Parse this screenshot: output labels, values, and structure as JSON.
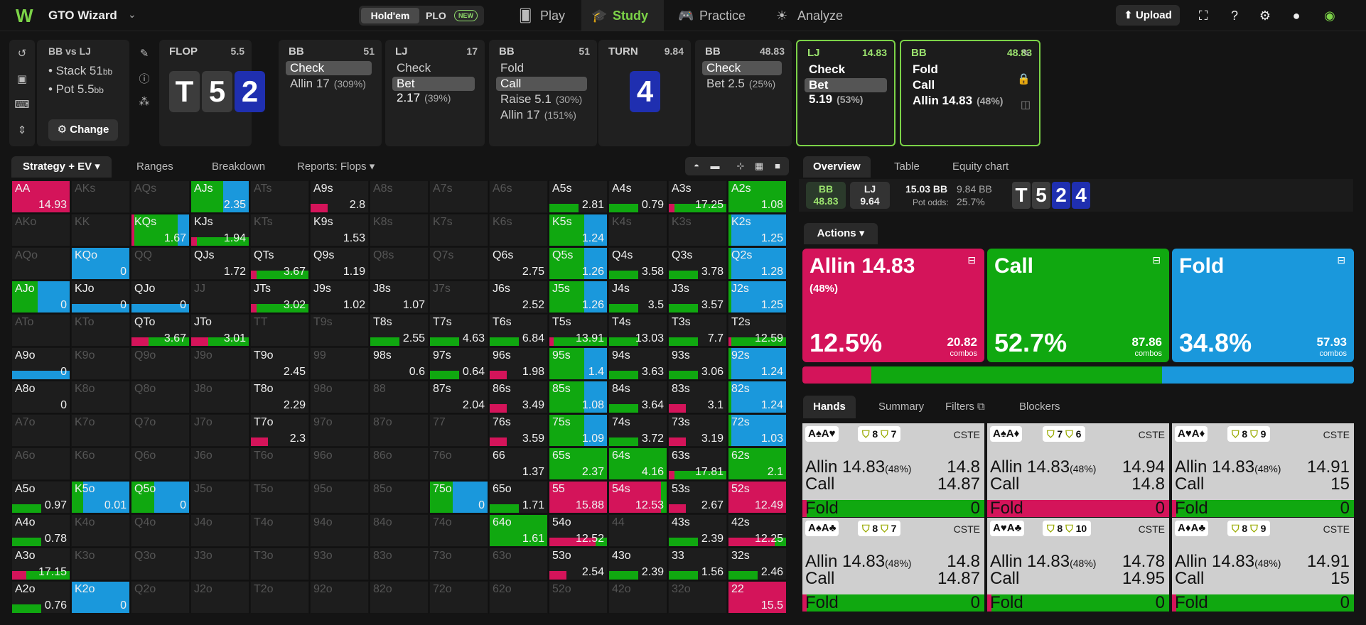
{
  "nav": {
    "brand": "GTO Wizard",
    "holdem": "Hold'em",
    "plo": "PLO",
    "new_badge": "NEW",
    "tabs": [
      "Play",
      "Study",
      "Practice",
      "Analyze"
    ],
    "upload": "Upload"
  },
  "spot": {
    "title": "BB vs LJ",
    "stack_label": "• Stack 51",
    "stack_unit": "bb",
    "pot_label": "• Pot 5.5",
    "pot_unit": "bb",
    "change": "Change"
  },
  "streets": [
    {
      "name": "FLOP",
      "pot": "5.5",
      "cards": [
        "T",
        "5",
        "2"
      ]
    },
    {
      "name": "BB",
      "pot": "51",
      "actions": [
        {
          "label": "Check",
          "sel": true
        },
        {
          "label": "Allin 17",
          "pct": "(309%)"
        }
      ]
    },
    {
      "name": "LJ",
      "pot": "17",
      "actions": [
        {
          "label": "Check"
        },
        {
          "label": "Bet 2.17",
          "pct": "(39%)",
          "sel": true
        }
      ]
    },
    {
      "name": "BB",
      "pot": "51",
      "actions": [
        {
          "label": "Fold"
        },
        {
          "label": "Call",
          "sel": true
        },
        {
          "label": "Raise 5.1",
          "pct": "(30%)"
        },
        {
          "label": "Allin 17",
          "pct": "(151%)"
        }
      ]
    },
    {
      "name": "TURN",
      "pot": "9.84",
      "cards": [
        "4"
      ]
    },
    {
      "name": "BB",
      "pot": "48.83",
      "actions": [
        {
          "label": "Check",
          "sel": true
        },
        {
          "label": "Bet 2.5",
          "pct": "(25%)"
        }
      ]
    },
    {
      "name": "LJ",
      "pot": "14.83",
      "actions": [
        {
          "label": "Check"
        },
        {
          "label": "Bet 5.19",
          "pct": "(53%)",
          "sel": true
        }
      ]
    },
    {
      "name": "BB",
      "pot": "48.83",
      "actions": [
        {
          "label": "Fold"
        },
        {
          "label": "Call"
        },
        {
          "label": "Allin 14.83",
          "pct": "(48%)"
        }
      ]
    }
  ],
  "left_tabs": [
    "Strategy + EV",
    "Ranges",
    "Breakdown",
    "Reports: Flops"
  ],
  "right_tabs": [
    "Overview",
    "Table",
    "Equity chart"
  ],
  "info": {
    "bb": "BB",
    "bb_val": "48.83",
    "lj": "LJ",
    "lj_val": "9.64",
    "pot": "15.03 BB",
    "pot2": "9.84 BB",
    "odds_label": "Pot odds:",
    "odds": "25.7%",
    "board": [
      "T",
      "5",
      "2",
      "4"
    ]
  },
  "actions_label": "Actions",
  "action_boxes": [
    {
      "name": "Allin 14.83",
      "sub": "(48%)",
      "pct": "12.5%",
      "combos": "20.82",
      "combos_label": "combos",
      "color": "#d4145a"
    },
    {
      "name": "Call",
      "sub": "",
      "pct": "52.7%",
      "combos": "87.86",
      "combos_label": "combos",
      "color": "#10a810"
    },
    {
      "name": "Fold",
      "sub": "",
      "pct": "34.8%",
      "combos": "57.93",
      "combos_label": "combos",
      "color": "#1a98dc"
    }
  ],
  "distribution": [
    12.5,
    52.7,
    34.8
  ],
  "hand_tabs": [
    "Hands",
    "Summary",
    "Filters",
    "Blockers"
  ],
  "hands": [
    {
      "cards": "A♠A♥",
      "blk1": "8",
      "blk2": "7",
      "cat": "CSTE",
      "allin": "14.8",
      "call": "14.87",
      "fold": "0",
      "fold_color": "#10a810"
    },
    {
      "cards": "A♠A♦",
      "blk1": "7",
      "blk2": "6",
      "cat": "CSTE",
      "allin": "14.94",
      "call": "14.8",
      "fold": "0",
      "fold_color": "#d4145a"
    },
    {
      "cards": "A♥A♦",
      "blk1": "8",
      "blk2": "9",
      "cat": "CSTE",
      "allin": "14.91",
      "call": "15",
      "fold": "0",
      "fold_color": "#10a810"
    },
    {
      "cards": "A♠A♣",
      "blk1": "8",
      "blk2": "7",
      "cat": "CSTE",
      "allin": "14.8",
      "call": "14.87",
      "fold": "0",
      "fold_color": "#10a810"
    },
    {
      "cards": "A♥A♣",
      "blk1": "8",
      "blk2": "10",
      "cat": "CSTE",
      "allin": "14.78",
      "call": "14.95",
      "fold": "0",
      "fold_color": "#10a810"
    },
    {
      "cards": "A♦A♣",
      "blk1": "8",
      "blk2": "9",
      "cat": "CSTE",
      "allin": "14.91",
      "call": "15",
      "fold": "0",
      "fold_color": "#10a810"
    }
  ],
  "hand_labels": {
    "allin": "Allin 14.83",
    "allin_pct": "(48%)",
    "call": "Call",
    "fold": "Fold"
  },
  "colors": {
    "allin": "#d4145a",
    "call": "#10a810",
    "fold": "#1a98dc",
    "accent": "#7cd348"
  },
  "grid": [
    [
      [
        "AA",
        "14.93",
        "A",
        100
      ],
      [
        "AKs",
        "",
        "",
        0
      ],
      [
        "AQs",
        "",
        "",
        0
      ],
      [
        "AJs",
        "2.35",
        "mix",
        0
      ],
      [
        "ATs",
        "",
        "",
        0
      ],
      [
        "A9s",
        "2.8",
        "ar",
        0
      ],
      [
        "A8s",
        "",
        "",
        0
      ],
      [
        "A7s",
        "",
        "",
        0
      ],
      [
        "A6s",
        "",
        "",
        0
      ],
      [
        "A5s",
        "2.81",
        "cl",
        0
      ],
      [
        "A4s",
        "0.79",
        "cl",
        0
      ],
      [
        "A3s",
        "17.25",
        "acl",
        0
      ],
      [
        "A2s",
        "1.08",
        "C",
        0
      ]
    ],
    [
      [
        "AKo",
        "",
        "",
        0
      ],
      [
        "KK",
        "",
        "",
        0
      ],
      [
        "KQs",
        "1.67",
        "kqs",
        0
      ],
      [
        "KJs",
        "1.94",
        "acl",
        0
      ],
      [
        "KTs",
        "",
        "",
        0
      ],
      [
        "K9s",
        "1.53",
        "",
        0
      ],
      [
        "K8s",
        "",
        "",
        0
      ],
      [
        "K7s",
        "",
        "",
        0
      ],
      [
        "K6s",
        "",
        "",
        0
      ],
      [
        "K5s",
        "1.24",
        "cf",
        0
      ],
      [
        "K4s",
        "",
        "",
        0
      ],
      [
        "K3s",
        "",
        "",
        0
      ],
      [
        "K2s",
        "1.25",
        "cf2",
        0
      ]
    ],
    [
      [
        "AQo",
        "",
        "",
        0
      ],
      [
        "KQo",
        "0",
        "F",
        0
      ],
      [
        "QQ",
        "",
        "",
        0
      ],
      [
        "QJs",
        "1.72",
        "",
        0
      ],
      [
        "QTs",
        "3.67",
        "acl",
        0
      ],
      [
        "Q9s",
        "1.19",
        "",
        0
      ],
      [
        "Q8s",
        "",
        "",
        0
      ],
      [
        "Q7s",
        "",
        "",
        0
      ],
      [
        "Q6s",
        "2.75",
        "",
        0
      ],
      [
        "Q5s",
        "1.26",
        "cf3",
        0
      ],
      [
        "Q4s",
        "3.58",
        "cl",
        0
      ],
      [
        "Q3s",
        "3.78",
        "cl",
        0
      ],
      [
        "Q2s",
        "1.28",
        "cf2",
        0
      ]
    ],
    [
      [
        "AJo",
        "0",
        "ajo",
        0
      ],
      [
        "KJo",
        "0",
        "fl",
        0
      ],
      [
        "QJo",
        "0",
        "fl",
        0
      ],
      [
        "JJ",
        "",
        "",
        0
      ],
      [
        "JTs",
        "3.02",
        "acl",
        0
      ],
      [
        "J9s",
        "1.02",
        "",
        0
      ],
      [
        "J8s",
        "1.07",
        "",
        0
      ],
      [
        "J7s",
        "",
        "",
        0
      ],
      [
        "J6s",
        "2.52",
        "",
        0
      ],
      [
        "J5s",
        "1.26",
        "cf3",
        0
      ],
      [
        "J4s",
        "3.5",
        "cl",
        0
      ],
      [
        "J3s",
        "3.57",
        "cl",
        0
      ],
      [
        "J2s",
        "1.25",
        "cf2",
        0
      ]
    ],
    [
      [
        "ATo",
        "",
        "",
        0
      ],
      [
        "KTo",
        "",
        "",
        0
      ],
      [
        "QTo",
        "3.67",
        "qto",
        0
      ],
      [
        "JTo",
        "3.01",
        "qto",
        0
      ],
      [
        "TT",
        "",
        "",
        0
      ],
      [
        "T9s",
        "",
        "",
        0
      ],
      [
        "T8s",
        "2.55",
        "cl",
        0
      ],
      [
        "T7s",
        "4.63",
        "cl",
        0
      ],
      [
        "T6s",
        "6.84",
        "cl",
        0
      ],
      [
        "T5s",
        "13.91",
        "t5s",
        0
      ],
      [
        "T4s",
        "13.03",
        "cl",
        0
      ],
      [
        "T3s",
        "7.7",
        "cl",
        0
      ],
      [
        "T2s",
        "12.59",
        "t2s",
        0
      ]
    ],
    [
      [
        "A9o",
        "0",
        "fl",
        0
      ],
      [
        "K9o",
        "",
        "",
        0
      ],
      [
        "Q9o",
        "",
        "",
        0
      ],
      [
        "J9o",
        "",
        "",
        0
      ],
      [
        "T9o",
        "2.45",
        "",
        0
      ],
      [
        "99",
        "",
        "",
        0
      ],
      [
        "98s",
        "0.6",
        "",
        0
      ],
      [
        "97s",
        "0.64",
        "cl",
        0
      ],
      [
        "96s",
        "1.98",
        "ar",
        0
      ],
      [
        "95s",
        "1.4",
        "cf",
        0
      ],
      [
        "94s",
        "3.63",
        "cl",
        0
      ],
      [
        "93s",
        "3.06",
        "cl",
        0
      ],
      [
        "92s",
        "1.24",
        "cf2",
        0
      ]
    ],
    [
      [
        "A8o",
        "0",
        "",
        0
      ],
      [
        "K8o",
        "",
        "",
        0
      ],
      [
        "Q8o",
        "",
        "",
        0
      ],
      [
        "J8o",
        "",
        "",
        0
      ],
      [
        "T8o",
        "2.29",
        "",
        0
      ],
      [
        "98o",
        "",
        "",
        0
      ],
      [
        "88",
        "",
        "",
        0
      ],
      [
        "87s",
        "2.04",
        "",
        0
      ],
      [
        "86s",
        "3.49",
        "ar",
        0
      ],
      [
        "85s",
        "1.08",
        "cf",
        0
      ],
      [
        "84s",
        "3.64",
        "cl",
        0
      ],
      [
        "83s",
        "3.1",
        "ar",
        0
      ],
      [
        "82s",
        "1.24",
        "cf2",
        0
      ]
    ],
    [
      [
        "A7o",
        "",
        "",
        0
      ],
      [
        "K7o",
        "",
        "",
        0
      ],
      [
        "Q7o",
        "",
        "",
        0
      ],
      [
        "J7o",
        "",
        "",
        0
      ],
      [
        "T7o",
        "2.3",
        "ar",
        0
      ],
      [
        "97o",
        "",
        "",
        0
      ],
      [
        "87o",
        "",
        "",
        0
      ],
      [
        "77",
        "",
        "",
        0
      ],
      [
        "76s",
        "3.59",
        "ar",
        0
      ],
      [
        "75s",
        "1.09",
        "cf",
        0
      ],
      [
        "74s",
        "3.72",
        "cl",
        0
      ],
      [
        "73s",
        "3.19",
        "ar",
        0
      ],
      [
        "72s",
        "1.03",
        "cf2",
        0
      ]
    ],
    [
      [
        "A6o",
        "",
        "",
        0
      ],
      [
        "K6o",
        "",
        "",
        0
      ],
      [
        "Q6o",
        "",
        "",
        0
      ],
      [
        "J6o",
        "",
        "",
        0
      ],
      [
        "T6o",
        "",
        "",
        0
      ],
      [
        "96o",
        "",
        "",
        0
      ],
      [
        "86o",
        "",
        "",
        0
      ],
      [
        "76o",
        "",
        "",
        0
      ],
      [
        "66",
        "1.37",
        "",
        0
      ],
      [
        "65s",
        "2.37",
        "C",
        0
      ],
      [
        "64s",
        "4.16",
        "C",
        0
      ],
      [
        "63s",
        "17.81",
        "acl",
        0
      ],
      [
        "62s",
        "2.1",
        "C",
        0
      ]
    ],
    [
      [
        "A5o",
        "0.97",
        "cl",
        0
      ],
      [
        "K5o",
        "0.01",
        "k5o",
        0
      ],
      [
        "Q5o",
        "0",
        "q5o",
        0
      ],
      [
        "J5o",
        "",
        "",
        0
      ],
      [
        "T5o",
        "",
        "",
        0
      ],
      [
        "95o",
        "",
        "",
        0
      ],
      [
        "85o",
        "",
        "",
        0
      ],
      [
        "75o",
        "0",
        "q5o",
        0
      ],
      [
        "65o",
        "1.71",
        "cl",
        0
      ],
      [
        "55",
        "15.88",
        "A",
        0
      ],
      [
        "54s",
        "12.53",
        "a54",
        0
      ],
      [
        "53s",
        "2.67",
        "ar",
        0
      ],
      [
        "52s",
        "12.49",
        "A",
        0
      ]
    ],
    [
      [
        "A4o",
        "0.78",
        "cl",
        0
      ],
      [
        "K4o",
        "",
        "",
        0
      ],
      [
        "Q4o",
        "",
        "",
        0
      ],
      [
        "J4o",
        "",
        "",
        0
      ],
      [
        "T4o",
        "",
        "",
        0
      ],
      [
        "94o",
        "",
        "",
        0
      ],
      [
        "84o",
        "",
        "",
        0
      ],
      [
        "74o",
        "",
        "",
        0
      ],
      [
        "64o",
        "1.61",
        "C",
        0
      ],
      [
        "54o",
        "12.52",
        "acl2",
        0
      ],
      [
        "44",
        "",
        "",
        0
      ],
      [
        "43s",
        "2.39",
        "cl",
        0
      ],
      [
        "42s",
        "12.25",
        "acl2",
        0
      ]
    ],
    [
      [
        "A3o",
        "17.15",
        "a3o",
        0
      ],
      [
        "K3o",
        "",
        "",
        0
      ],
      [
        "Q3o",
        "",
        "",
        0
      ],
      [
        "J3o",
        "",
        "",
        0
      ],
      [
        "T3o",
        "",
        "",
        0
      ],
      [
        "93o",
        "",
        "",
        0
      ],
      [
        "83o",
        "",
        "",
        0
      ],
      [
        "73o",
        "",
        "",
        0
      ],
      [
        "63o",
        "",
        "",
        0
      ],
      [
        "53o",
        "2.54",
        "ar",
        0
      ],
      [
        "43o",
        "2.39",
        "cl",
        0
      ],
      [
        "33",
        "1.56",
        "cl",
        0
      ],
      [
        "32s",
        "2.46",
        "cl",
        0
      ]
    ],
    [
      [
        "A2o",
        "0.76",
        "cl",
        0
      ],
      [
        "K2o",
        "0",
        "F",
        0
      ],
      [
        "Q2o",
        "",
        "",
        0
      ],
      [
        "J2o",
        "",
        "",
        0
      ],
      [
        "T2o",
        "",
        "",
        0
      ],
      [
        "92o",
        "",
        "",
        0
      ],
      [
        "82o",
        "",
        "",
        0
      ],
      [
        "72o",
        "",
        "",
        0
      ],
      [
        "62o",
        "",
        "",
        0
      ],
      [
        "52o",
        "",
        "",
        0
      ],
      [
        "42o",
        "",
        "",
        0
      ],
      [
        "32o",
        "",
        "",
        0
      ],
      [
        "22",
        "15.5",
        "A",
        0
      ]
    ]
  ]
}
